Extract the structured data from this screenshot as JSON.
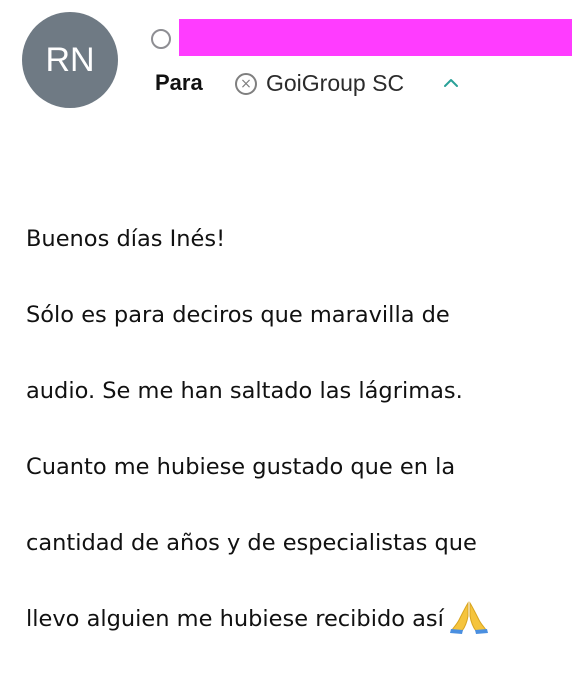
{
  "header": {
    "avatar_initials": "RN",
    "avatar_color": "#6f7a84",
    "redaction_color": "#ff3cff",
    "to_label": "Para",
    "recipient": "GoiGroup SC",
    "remove_icon": "circle-x-icon",
    "collapse_icon": "chevron-up-icon",
    "accent_color": "#2aa198"
  },
  "message": {
    "lines": [
      "Buenos días Inés!",
      "Sólo es para deciros que maravilla de",
      "audio. Se me han saltado las lágrimas.",
      "Cuanto me hubiese gustado que en la",
      "cantidad de años y de especialistas que",
      "llevo alguien me hubiese recibido así"
    ],
    "emoji": "folded-hands-emoji"
  }
}
